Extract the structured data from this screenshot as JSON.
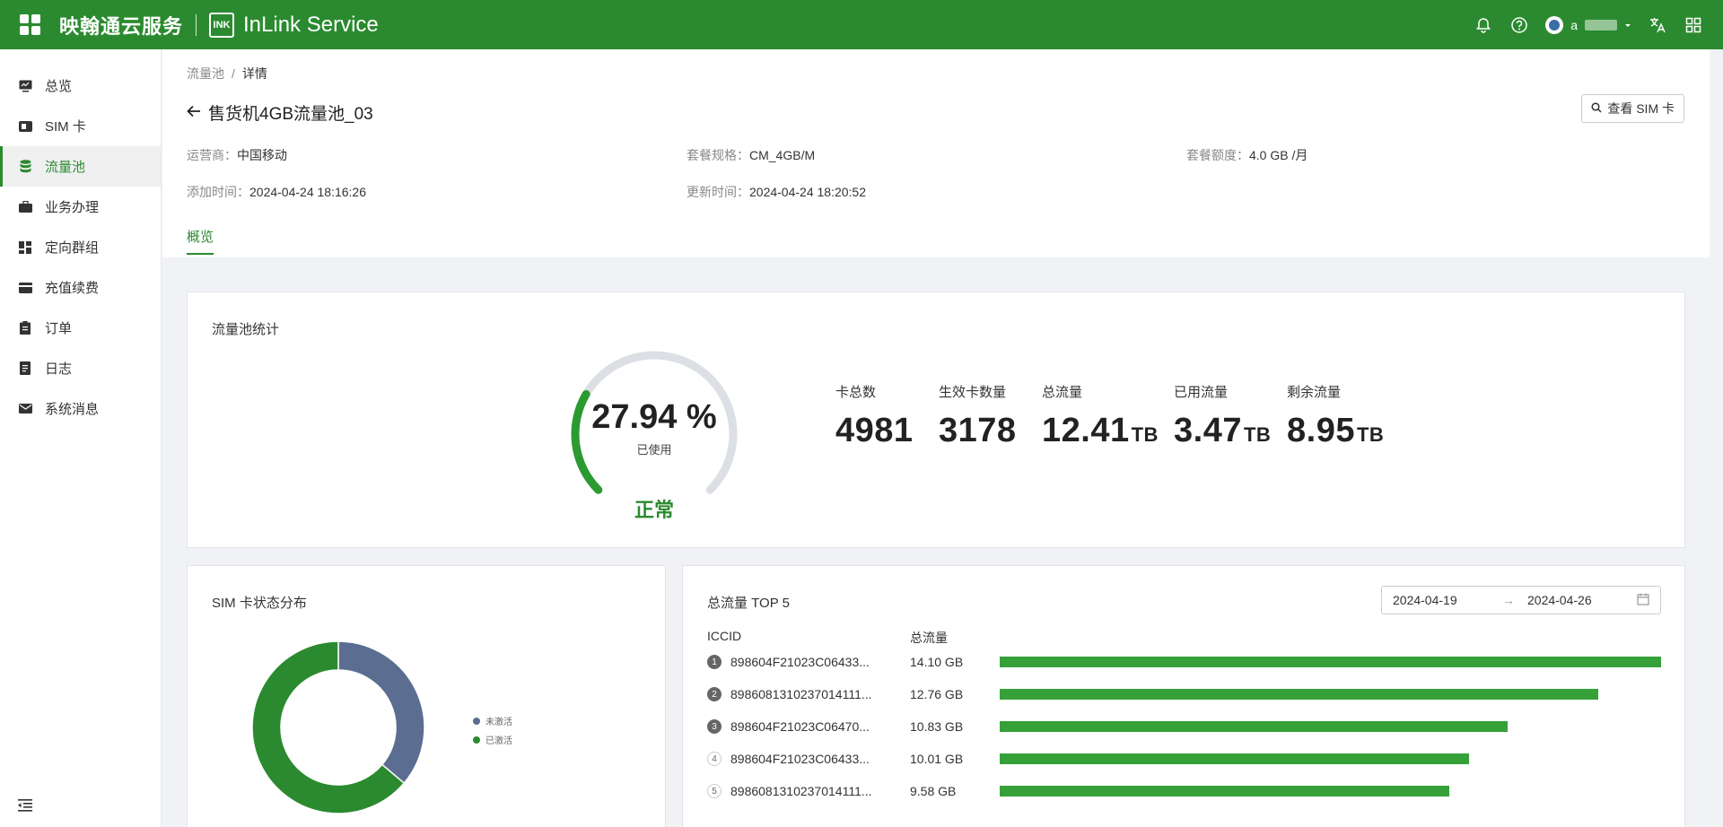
{
  "header": {
    "brand_cn": "映翰通云服务",
    "brand_logo": "INK",
    "brand_en": "InLink Service",
    "user_initial": "a",
    "accent": "#2b8a2f"
  },
  "sidebar": {
    "items": [
      {
        "label": "总览",
        "icon": "monitor-icon"
      },
      {
        "label": "SIM 卡",
        "icon": "sim-card-icon"
      },
      {
        "label": "流量池",
        "icon": "database-icon",
        "active": true
      },
      {
        "label": "业务办理",
        "icon": "briefcase-icon"
      },
      {
        "label": "定向群组",
        "icon": "dashboard-icon"
      },
      {
        "label": "充值续费",
        "icon": "credit-card-icon"
      },
      {
        "label": "订单",
        "icon": "clipboard-icon"
      },
      {
        "label": "日志",
        "icon": "file-list-icon"
      },
      {
        "label": "系统消息",
        "icon": "mail-icon"
      }
    ]
  },
  "breadcrumb": {
    "parent": "流量池",
    "sep": "/",
    "current": "详情"
  },
  "page": {
    "title": "售货机4GB流量池_03",
    "view_sim_label": "查看 SIM 卡"
  },
  "info": {
    "operator_k": "运营商：",
    "operator_v": "中国移动",
    "plan_k": "套餐规格：",
    "plan_v": "CM_4GB/M",
    "quota_k": "套餐额度：",
    "quota_v": "4.0 GB /月",
    "added_k": "添加时间：",
    "added_v": "2024-04-24 18:16:26",
    "updated_k": "更新时间：",
    "updated_v": "2024-04-24 18:20:52"
  },
  "tab": "概览",
  "pool_stats": {
    "title": "流量池统计",
    "used_percent_label": "27.94 %",
    "used_fraction": 0.2794,
    "used_label": "已使用",
    "status": "正常",
    "items": [
      {
        "label": "卡总数",
        "value": "4981",
        "unit": ""
      },
      {
        "label": "生效卡数量",
        "value": "3178",
        "unit": ""
      },
      {
        "label": "总流量",
        "value": "12.41",
        "unit": "TB"
      },
      {
        "label": "已用流量",
        "value": "3.47",
        "unit": "TB"
      },
      {
        "label": "剩余流量",
        "value": "8.95",
        "unit": "TB"
      }
    ]
  },
  "sim_status": {
    "title": "SIM 卡状态分布",
    "legend_unactivated": "未激活",
    "legend_activated": "已激活",
    "colors": {
      "unactivated": "#5b6e91",
      "activated": "#2b8a2f"
    }
  },
  "top5": {
    "title": "总流量 TOP 5",
    "date_start": "2024-04-19",
    "date_end": "2024-04-26",
    "col_iccid": "ICCID",
    "col_traffic": "总流量",
    "rows": [
      {
        "rank": "1",
        "iccid": "898604F21023C06433...",
        "traffic": "14.10 GB"
      },
      {
        "rank": "2",
        "iccid": "8986081310237014111...",
        "traffic": "12.76 GB"
      },
      {
        "rank": "3",
        "iccid": "898604F21023C06470...",
        "traffic": "10.83 GB"
      },
      {
        "rank": "4",
        "iccid": "898604F21023C06433...",
        "traffic": "10.01 GB"
      },
      {
        "rank": "5",
        "iccid": "8986081310237014111...",
        "traffic": "9.58 GB"
      }
    ]
  },
  "chart_data": [
    {
      "type": "pie",
      "title": "SIM 卡状态分布",
      "categories": [
        "未激活",
        "已激活"
      ],
      "values": [
        1803,
        3178
      ]
    },
    {
      "type": "bar",
      "title": "总流量 TOP 5",
      "categories": [
        "898604F21023C06433...",
        "8986081310237014111...",
        "898604F21023C06470...",
        "898604F21023C06433...",
        "8986081310237014111..."
      ],
      "values": [
        14.1,
        12.76,
        10.83,
        10.01,
        9.58
      ]
    }
  ]
}
